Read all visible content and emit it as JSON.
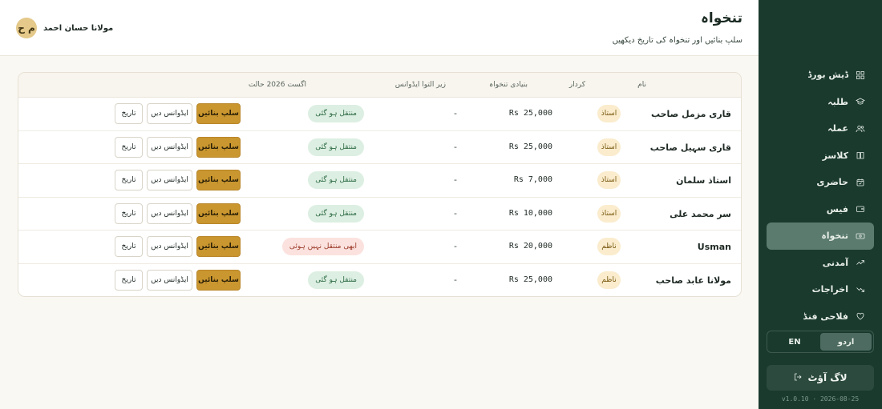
{
  "header": {
    "title": "تنخواہ",
    "subtitle": "سلپ بنائیں اور تنخواہ کی تاریخ دیکھیں",
    "user_name": "مولانا حسان احمد",
    "avatar_initials": "م ح"
  },
  "table": {
    "headers": {
      "name": "نام",
      "role": "کردار",
      "salary": "بنیادی تنخواہ",
      "advance": "زیر التوا ایڈوانس",
      "status": "اگست 2026 حالت"
    },
    "actions": {
      "slip": "سلپ بنائیں",
      "advance": "ایڈوانس دیں",
      "history": "تاریخ"
    },
    "rows": [
      {
        "name": "قاری مزمل صاحب",
        "role": "استاذ",
        "salary": "Rs 25,000",
        "advance": "-",
        "status": "منتقل ہو گئی",
        "status_type": "ok"
      },
      {
        "name": "قاری سہیل صاحب",
        "role": "استاذ",
        "salary": "Rs 25,000",
        "advance": "-",
        "status": "منتقل ہو گئی",
        "status_type": "ok"
      },
      {
        "name": "استاذ سلمان",
        "role": "استاذ",
        "salary": "Rs 7,000",
        "advance": "-",
        "status": "منتقل ہو گئی",
        "status_type": "ok"
      },
      {
        "name": "سر محمد علی",
        "role": "استاذ",
        "salary": "Rs 10,000",
        "advance": "-",
        "status": "منتقل ہو گئی",
        "status_type": "ok"
      },
      {
        "name": "Usman",
        "role": "ناظم",
        "salary": "Rs 20,000",
        "advance": "-",
        "status": "ابھی منتقل نہیں ہوئی",
        "status_type": "no"
      },
      {
        "name": "مولانا عابد صاحب",
        "role": "ناظم",
        "salary": "Rs 25,000",
        "advance": "-",
        "status": "منتقل ہو گئی",
        "status_type": "ok"
      }
    ]
  },
  "sidebar": {
    "items": [
      {
        "label": "ڈیش بورڈ",
        "icon": "dashboard-icon",
        "active": false
      },
      {
        "label": "طلبہ",
        "icon": "graduation-cap-icon",
        "active": false
      },
      {
        "label": "عملہ",
        "icon": "users-icon",
        "active": false
      },
      {
        "label": "کلاسز",
        "icon": "book-icon",
        "active": false
      },
      {
        "label": "حاضری",
        "icon": "calendar-check-icon",
        "active": false
      },
      {
        "label": "فیس",
        "icon": "wallet-icon",
        "active": false
      },
      {
        "label": "تنخواہ",
        "icon": "banknote-icon",
        "active": true
      },
      {
        "label": "آمدنی",
        "icon": "trending-up-icon",
        "active": false
      },
      {
        "label": "اخراجات",
        "icon": "trending-down-icon",
        "active": false
      },
      {
        "label": "فلاحی فنڈ",
        "icon": "heart-hand-icon",
        "active": false
      }
    ],
    "lang_en": "EN",
    "lang_ur": "اردو",
    "active_lang": "ur",
    "logout": "لاگ آؤٹ",
    "version": "v1.0.10 · 2026-08-25"
  },
  "colors": {
    "sidebar_bg": "#1a3a2e",
    "active_item": "#5b7b6f",
    "accent_gold": "#c9962f",
    "status_ok_bg": "#dcefe2",
    "status_no_bg": "#fbe2de"
  }
}
